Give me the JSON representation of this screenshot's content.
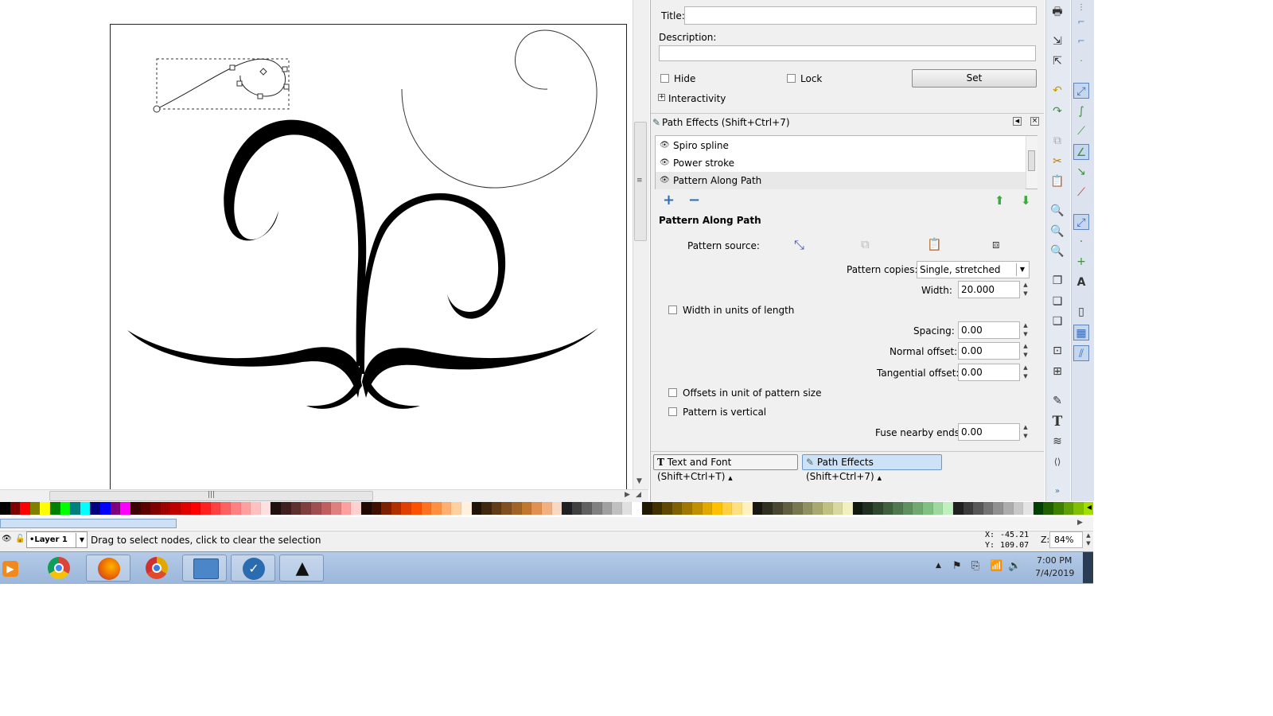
{
  "object_properties": {
    "title_label": "Title:",
    "title_value": "",
    "description_label": "Description:",
    "description_value": "",
    "hide_label": "Hide",
    "lock_label": "Lock",
    "set_label": "Set",
    "interactivity_label": "Interactivity"
  },
  "path_effects": {
    "panel_title": "Path Effects  (Shift+Ctrl+7)",
    "effects": [
      "Spiro spline",
      "Power stroke",
      "Pattern Along Path"
    ],
    "selected_index": 2,
    "section_title": "Pattern Along Path",
    "pattern_source_label": "Pattern source:",
    "pattern_copies_label": "Pattern copies:",
    "pattern_copies_value": "Single, stretched",
    "width_label": "Width:",
    "width_value": "20.000",
    "width_units_label": "Width in units of length",
    "spacing_label": "Spacing:",
    "spacing_value": "0.00",
    "normal_offset_label": "Normal offset:",
    "normal_offset_value": "0.00",
    "tangential_offset_label": "Tangential offset:",
    "tangential_offset_value": "0.00",
    "offsets_unit_label": "Offsets in unit of pattern size",
    "pattern_vertical_label": "Pattern is vertical",
    "fuse_label": "Fuse nearby ends:",
    "fuse_value": "0.00"
  },
  "dock_tabs": [
    {
      "label": "Text and Font (Shift+Ctrl+T)",
      "active": false
    },
    {
      "label": "Path Effects  (Shift+Ctrl+7)",
      "active": true
    }
  ],
  "status": {
    "layer": "•Layer 1",
    "message": "Drag to select nodes, click to clear the selection",
    "x_label": "X:",
    "x_value": "-45.21",
    "y_label": "Y:",
    "y_value": "109.07",
    "zoom_label": "Z:",
    "zoom_value": "84%"
  },
  "taskbar": {
    "apps": [
      "media-player-icon",
      "chrome-icon",
      "firefox-icon",
      "chrome-canary-icon",
      "control-panel-icon",
      "vectr-icon",
      "inkscape-icon"
    ],
    "time": "7:00 PM",
    "date": "7/4/2019"
  },
  "palette_colors": [
    "#000000",
    "#7f0000",
    "#ff0000",
    "#7f7f00",
    "#ffff00",
    "#007f00",
    "#00ff00",
    "#007f7f",
    "#00ffff",
    "#00007f",
    "#0000ff",
    "#7f007f",
    "#ff00ff",
    "#3f0000",
    "#5f0000",
    "#7f0000",
    "#9f0000",
    "#bf0000",
    "#df0000",
    "#ff0000",
    "#ff2020",
    "#ff4040",
    "#ff6060",
    "#ff8080",
    "#ffa0a0",
    "#ffc0c0",
    "#ffe0e0",
    "#1f0f0f",
    "#3f1f1f",
    "#5f2f2f",
    "#7f3f3f",
    "#9f4f4f",
    "#bf5f5f",
    "#df7f7f",
    "#ffa0a0",
    "#ffd0d0",
    "#200800",
    "#401000",
    "#802000",
    "#b03000",
    "#e04000",
    "#ff5000",
    "#ff7020",
    "#ff9040",
    "#ffb070",
    "#ffd0a0",
    "#fff0e0",
    "#201408",
    "#402810",
    "#603c18",
    "#805020",
    "#a06428",
    "#c07830",
    "#e09050",
    "#f0b080",
    "#f8d8c0",
    "#202020",
    "#404040",
    "#606060",
    "#808080",
    "#a0a0a0",
    "#c0c0c0",
    "#e0e0e0",
    "#ffffff",
    "#201800",
    "#403000",
    "#604800",
    "#806000",
    "#a07800",
    "#c09000",
    "#e0a800",
    "#ffc000",
    "#ffd040",
    "#ffe080",
    "#fff0c0",
    "#181810",
    "#303020",
    "#484830",
    "#606040",
    "#787850",
    "#909060",
    "#a8a870",
    "#c0c080",
    "#d8d8a0",
    "#f0f0c0",
    "#101810",
    "#203020",
    "#304830",
    "#406040",
    "#507850",
    "#609060",
    "#70a870",
    "#80c080",
    "#a0d8a0",
    "#c0f0c0",
    "#202020",
    "#3c3c3c",
    "#585858",
    "#747474",
    "#909090",
    "#acacac",
    "#c8c8c8",
    "#e4e4e4",
    "#004000",
    "#206000",
    "#408000",
    "#60a000",
    "#80c000",
    "#a0e000"
  ]
}
